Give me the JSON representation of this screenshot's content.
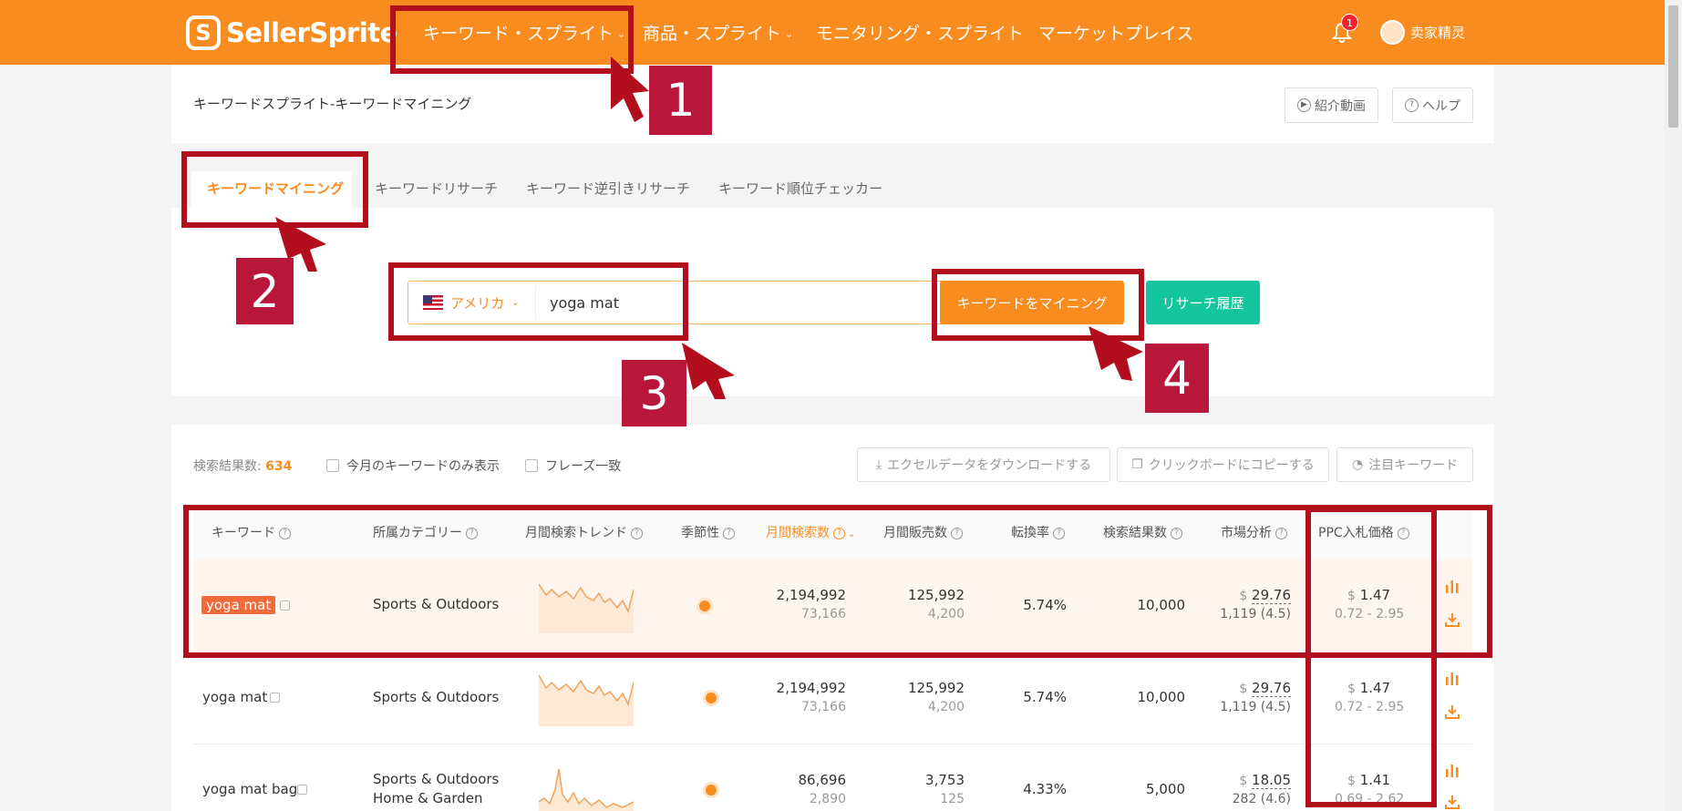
{
  "brand": {
    "name": "SellerSprite"
  },
  "nav": {
    "items": [
      {
        "label": "キーワード・スプライト",
        "has_dropdown": true
      },
      {
        "label": "商品・スプライト",
        "has_dropdown": true
      },
      {
        "label": "モニタリング・スプライト",
        "has_dropdown": false
      },
      {
        "label": "マーケットプレイス",
        "has_dropdown": false
      }
    ],
    "notification_count": "1",
    "user_name": "卖家精灵"
  },
  "header": {
    "title": "キーワードスプライト-キーワードマイニング",
    "video_button": "紹介動画",
    "help_button": "ヘルプ"
  },
  "tabs": [
    {
      "label": "キーワードマイニング",
      "active": true
    },
    {
      "label": "キーワードリサーチ",
      "active": false
    },
    {
      "label": "キーワード逆引きリサーチ",
      "active": false
    },
    {
      "label": "キーワード順位チェッカー",
      "active": false
    }
  ],
  "search": {
    "country": "アメリカ",
    "value": "yoga mat",
    "mine_button": "キーワードをマイニング",
    "history_button": "リサーチ履歴"
  },
  "results": {
    "count_label": "検索結果数:",
    "count": "634",
    "filter_month_only": "今月のキーワードのみ表示",
    "filter_phrase": "フレーズ一致",
    "export_button": "エクセルデータをダウンロードする",
    "copy_button": "クリックボードにコピーする",
    "watch_button": "注目キーワード"
  },
  "table": {
    "columns": [
      "キーワード",
      "所属カテゴリー",
      "月間検索トレンド",
      "季節性",
      "月間検索数",
      "月間販売数",
      "転換率",
      "検索結果数",
      "市場分析",
      "PPC入札価格"
    ],
    "rows": [
      {
        "keyword": "yoga mat",
        "category": "Sports & Outdoors",
        "category2": "",
        "searches": "2,194,992",
        "searches_sub": "73,166",
        "sales": "125,992",
        "sales_sub": "4,200",
        "conversion": "5.74%",
        "results": "10,000",
        "price": "29.76",
        "reviews": "1,119 (4.5)",
        "ppc": "1.47",
        "ppc_range": "0.72 - 2.95",
        "highlight": true
      },
      {
        "keyword": "yoga mat",
        "category": "Sports & Outdoors",
        "category2": "",
        "searches": "2,194,992",
        "searches_sub": "73,166",
        "sales": "125,992",
        "sales_sub": "4,200",
        "conversion": "5.74%",
        "results": "10,000",
        "price": "29.76",
        "reviews": "1,119 (4.5)",
        "ppc": "1.47",
        "ppc_range": "0.72 - 2.95",
        "highlight": false
      },
      {
        "keyword": "yoga mat bag",
        "category": "Sports & Outdoors",
        "category2": "Home & Garden",
        "searches": "86,696",
        "searches_sub": "2,890",
        "sales": "3,753",
        "sales_sub": "125",
        "conversion": "4.33%",
        "results": "5,000",
        "price": "18.05",
        "reviews": "282 (4.6)",
        "ppc": "1.41",
        "ppc_range": "0.69 - 2.62",
        "highlight": false
      }
    ],
    "currency": "$"
  },
  "annotations": [
    "1",
    "2",
    "3",
    "4"
  ],
  "colors": {
    "brand_orange": "#f98c1e",
    "teal": "#14c49c",
    "annotation_red": "#b20e1e",
    "tag_red": "#f06a3b"
  }
}
